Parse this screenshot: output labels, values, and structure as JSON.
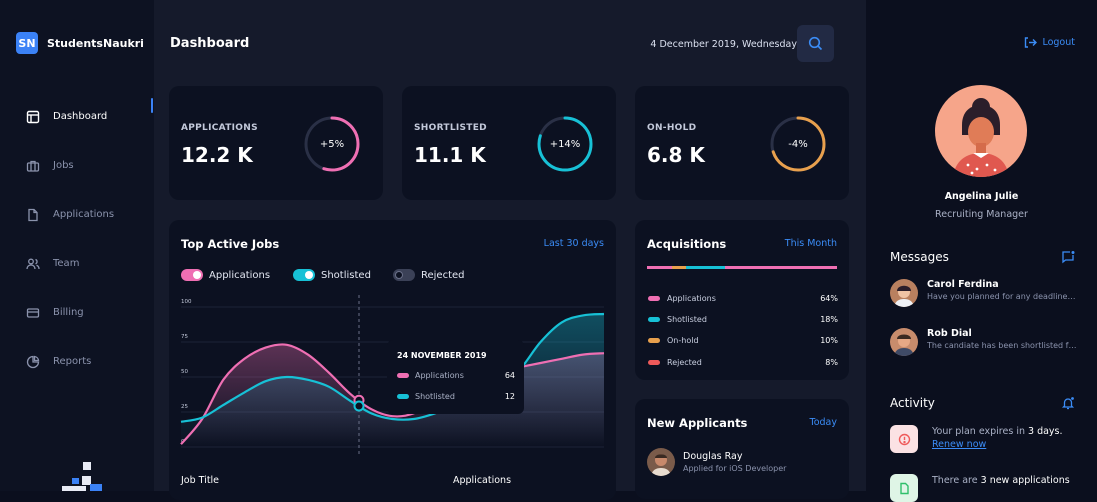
{
  "brand": {
    "logo_initials": "SN",
    "name": "StudentsNaukri"
  },
  "nav": [
    {
      "label": "Dashboard",
      "icon": "layout-icon",
      "active": true
    },
    {
      "label": "Jobs",
      "icon": "briefcase-icon"
    },
    {
      "label": "Applications",
      "icon": "file-icon"
    },
    {
      "label": "Team",
      "icon": "users-icon"
    },
    {
      "label": "Billing",
      "icon": "credit-card-icon"
    },
    {
      "label": "Reports",
      "icon": "pie-chart-icon"
    }
  ],
  "header": {
    "title": "Dashboard",
    "date": "4 December 2019, Wednesday"
  },
  "stats": [
    {
      "label": "APPLICATIONS",
      "value": "12.2 K",
      "change": "+5%",
      "color": "#ef6fb3",
      "progress": 0.55
    },
    {
      "label": "SHORTLISTED",
      "value": "11.1 K",
      "change": "+14%",
      "color": "#17c1d6",
      "progress": 0.8
    },
    {
      "label": "ON-HOLD",
      "value": "6.8 K",
      "change": "-4%",
      "color": "#e8a04d",
      "progress": 0.7
    }
  ],
  "top_jobs": {
    "title": "Top Active Jobs",
    "range_link": "Last 30 days",
    "toggles": [
      {
        "label": "Applications",
        "on": true,
        "color": "#ef6fb3"
      },
      {
        "label": "Shotlisted",
        "on": true,
        "color": "#17c1d6"
      },
      {
        "label": "Rejected",
        "on": false,
        "color": "#3b4157"
      }
    ],
    "tooltip": {
      "date": "24 NOVEMBER 2019",
      "rows": [
        {
          "label": "Applications",
          "value": "64"
        },
        {
          "label": "Shotlisted",
          "value": "12"
        }
      ]
    },
    "table_headers": {
      "col1": "Job Title",
      "col2": "Applications"
    }
  },
  "chart_data": {
    "type": "area",
    "ylim": [
      0,
      100
    ],
    "yticks": [
      "100",
      "75",
      "50",
      "25",
      "0"
    ],
    "x": [
      0,
      1,
      2,
      3,
      4,
      5,
      6,
      7,
      8,
      9,
      10,
      11,
      12,
      13,
      14,
      15,
      16,
      17,
      18,
      19,
      20
    ],
    "series": [
      {
        "name": "Applications",
        "color": "#ef6fb3",
        "values": [
          2,
          20,
          48,
          63,
          71,
          73,
          66,
          53,
          38,
          27,
          22,
          24,
          33,
          43,
          50,
          54,
          57,
          60,
          63,
          66,
          67
        ]
      },
      {
        "name": "Shotlisted",
        "color": "#17c1d6",
        "values": [
          18,
          21,
          30,
          39,
          47,
          50,
          48,
          43,
          33,
          24,
          20,
          20,
          24,
          30,
          36,
          43,
          55,
          75,
          89,
          94,
          95
        ]
      }
    ]
  },
  "acquisitions": {
    "title": "Acquisitions",
    "link": "This Month",
    "rows": [
      {
        "label": "Applications",
        "pct": "64%",
        "color": "#ef6fb3"
      },
      {
        "label": "Shotlisted",
        "pct": "18%",
        "color": "#17c1d6"
      },
      {
        "label": "On-hold",
        "pct": "10%",
        "color": "#e8a04d"
      },
      {
        "label": "Rejected",
        "pct": "8%",
        "color": "#ef5a5a"
      }
    ]
  },
  "new_applicants": {
    "title": "New Applicants",
    "link": "Today",
    "first": {
      "name": "Douglas Ray",
      "role": "Applied for iOS Developer"
    }
  },
  "right_panel": {
    "logout": "Logout",
    "profile": {
      "name": "Angelina Julie",
      "role": "Recruiting Manager"
    },
    "messages_title": "Messages",
    "messages": [
      {
        "name": "Carol Ferdina",
        "text": "Have you planned for any deadline for this?"
      },
      {
        "name": "Rob Dial",
        "text": "The candiate has been shortlisted for next round"
      }
    ],
    "activity_title": "Activity",
    "activity": [
      {
        "text_a": "Your plan expires in ",
        "text_b": "3 days.",
        "link": "Renew now",
        "color": "#fbe2e4",
        "icon": "alert-icon"
      },
      {
        "text_a": "There are ",
        "text_b": "3 new applications",
        "color": "#dff5e6",
        "icon": "document-icon"
      }
    ]
  }
}
